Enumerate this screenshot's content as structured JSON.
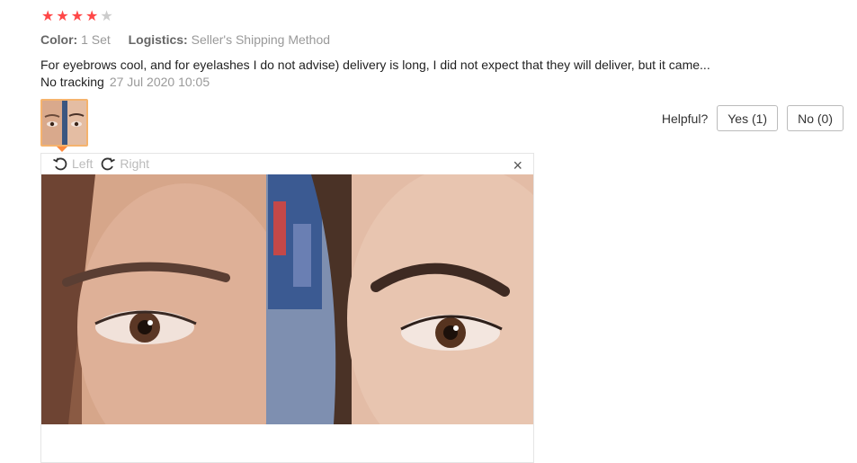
{
  "review": {
    "rating": 4,
    "max_rating": 5,
    "color_label": "Color:",
    "color_value": "1 Set",
    "logistics_label": "Logistics:",
    "logistics_value": "Seller's Shipping Method",
    "text": "For eyebrows cool, and for eyelashes I do not advise) delivery is long, I did not expect that they will deliver, but it came... No tracking",
    "date": "27 Jul 2020 10:05"
  },
  "helpful": {
    "label": "Helpful?",
    "yes_label": "Yes (1)",
    "no_label": "No (0)"
  },
  "viewer": {
    "rotate_left_label": "Left",
    "rotate_right_label": "Right",
    "close_glyph": "×",
    "photo": "before-after eyebrow comparison"
  },
  "colors": {
    "star_on": "#ff4747",
    "star_off": "#cccccc",
    "thumb_border": "#f5b36d"
  }
}
